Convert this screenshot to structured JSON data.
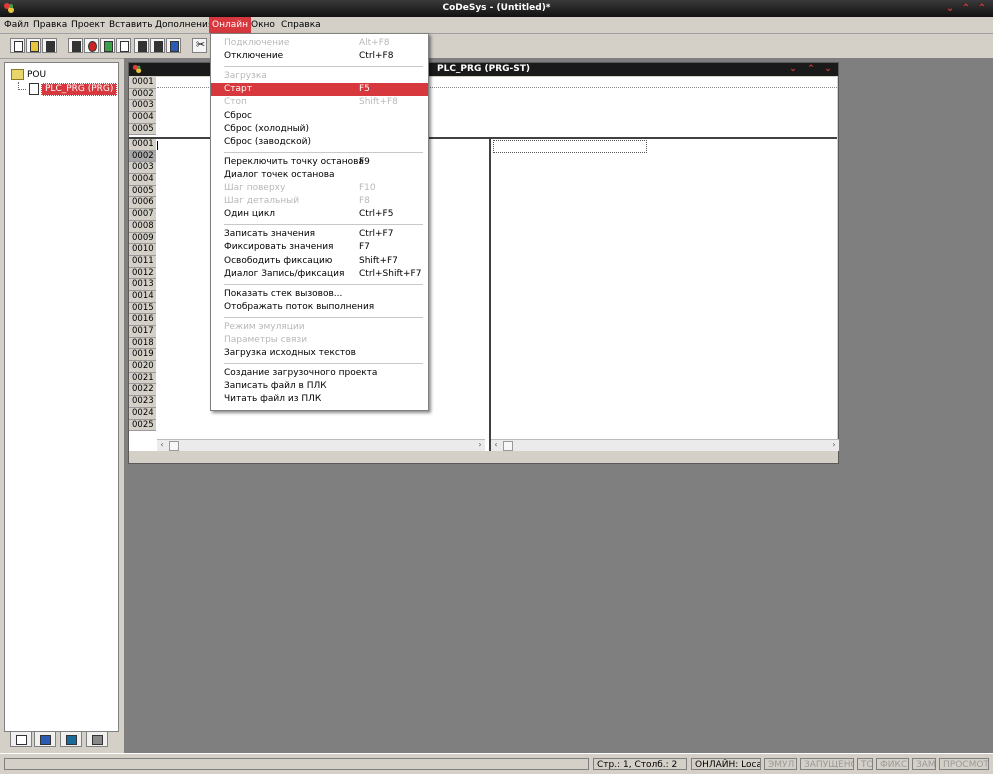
{
  "window": {
    "title": "CoDeSys - (Untitled)*"
  },
  "menubar": [
    "Файл",
    "Правка",
    "Проект",
    "Вставить",
    "Дополнения",
    "Онлайн",
    "Окно",
    "Справка"
  ],
  "tree": {
    "root": "POU",
    "item": "PLC_PRG (PRG)"
  },
  "editor": {
    "title": "PLC_PRG (PRG-ST)",
    "decl_lines": [
      "0001",
      "0002",
      "0003",
      "0004",
      "0005"
    ],
    "body_lines": [
      "0001",
      "0002",
      "0003",
      "0004",
      "0005",
      "0006",
      "0007",
      "0008",
      "0009",
      "0010",
      "0011",
      "0012",
      "0013",
      "0014",
      "0015",
      "0016",
      "0017",
      "0018",
      "0019",
      "0020",
      "0021",
      "0022",
      "0023",
      "0024",
      "0025"
    ]
  },
  "dropdown": {
    "items": [
      {
        "label": "Подключение",
        "shortcut": "Alt+F8",
        "disabled": true
      },
      {
        "label": "Отключение",
        "shortcut": "Ctrl+F8"
      },
      {
        "sep": true
      },
      {
        "label": "Загрузка",
        "shortcut": "",
        "disabled": true
      },
      {
        "label": "Старт",
        "shortcut": "F5",
        "highlighted": true
      },
      {
        "label": "Стоп",
        "shortcut": "Shift+F8",
        "disabled": true
      },
      {
        "label": "Сброс",
        "shortcut": ""
      },
      {
        "label": "Сброс (холодный)",
        "shortcut": ""
      },
      {
        "label": "Сброс (заводской)",
        "shortcut": ""
      },
      {
        "sep": true
      },
      {
        "label": "Переключить точку останова",
        "shortcut": "F9"
      },
      {
        "label": "Диалог точек останова",
        "shortcut": ""
      },
      {
        "label": "Шаг поверху",
        "shortcut": "F10",
        "disabled": true
      },
      {
        "label": "Шаг детальный",
        "shortcut": "F8",
        "disabled": true
      },
      {
        "label": "Один цикл",
        "shortcut": "Ctrl+F5"
      },
      {
        "sep": true
      },
      {
        "label": "Записать значения",
        "shortcut": "Ctrl+F7"
      },
      {
        "label": "Фиксировать значения",
        "shortcut": "F7"
      },
      {
        "label": "Освободить фиксацию",
        "shortcut": "Shift+F7"
      },
      {
        "label": "Диалог Запись/фиксация",
        "shortcut": "Ctrl+Shift+F7"
      },
      {
        "sep": true
      },
      {
        "label": "Показать стек вызовов...",
        "shortcut": ""
      },
      {
        "label": "Отображать поток выполнения",
        "shortcut": ""
      },
      {
        "sep": true
      },
      {
        "label": "Режим эмуляции",
        "shortcut": "",
        "disabled": true
      },
      {
        "label": "Параметры связи",
        "shortcut": "",
        "disabled": true
      },
      {
        "label": "Загрузка исходных текстов",
        "shortcut": ""
      },
      {
        "sep": true
      },
      {
        "label": "Создание загрузочного проекта",
        "shortcut": ""
      },
      {
        "label": "Записать файл в ПЛК",
        "shortcut": ""
      },
      {
        "label": "Читать файл из ПЛК",
        "shortcut": ""
      }
    ]
  },
  "status": {
    "position": "Стр.: 1, Столб.: 2",
    "online": "ОНЛАЙН: Local_",
    "emul": "ЭМУЛ",
    "running": "ЗАПУЩЕНО",
    "bp": "ТО",
    "forced": "ФИКС",
    "overwrite": "ЗАМ",
    "readonly": "ПРОСМОТР"
  }
}
